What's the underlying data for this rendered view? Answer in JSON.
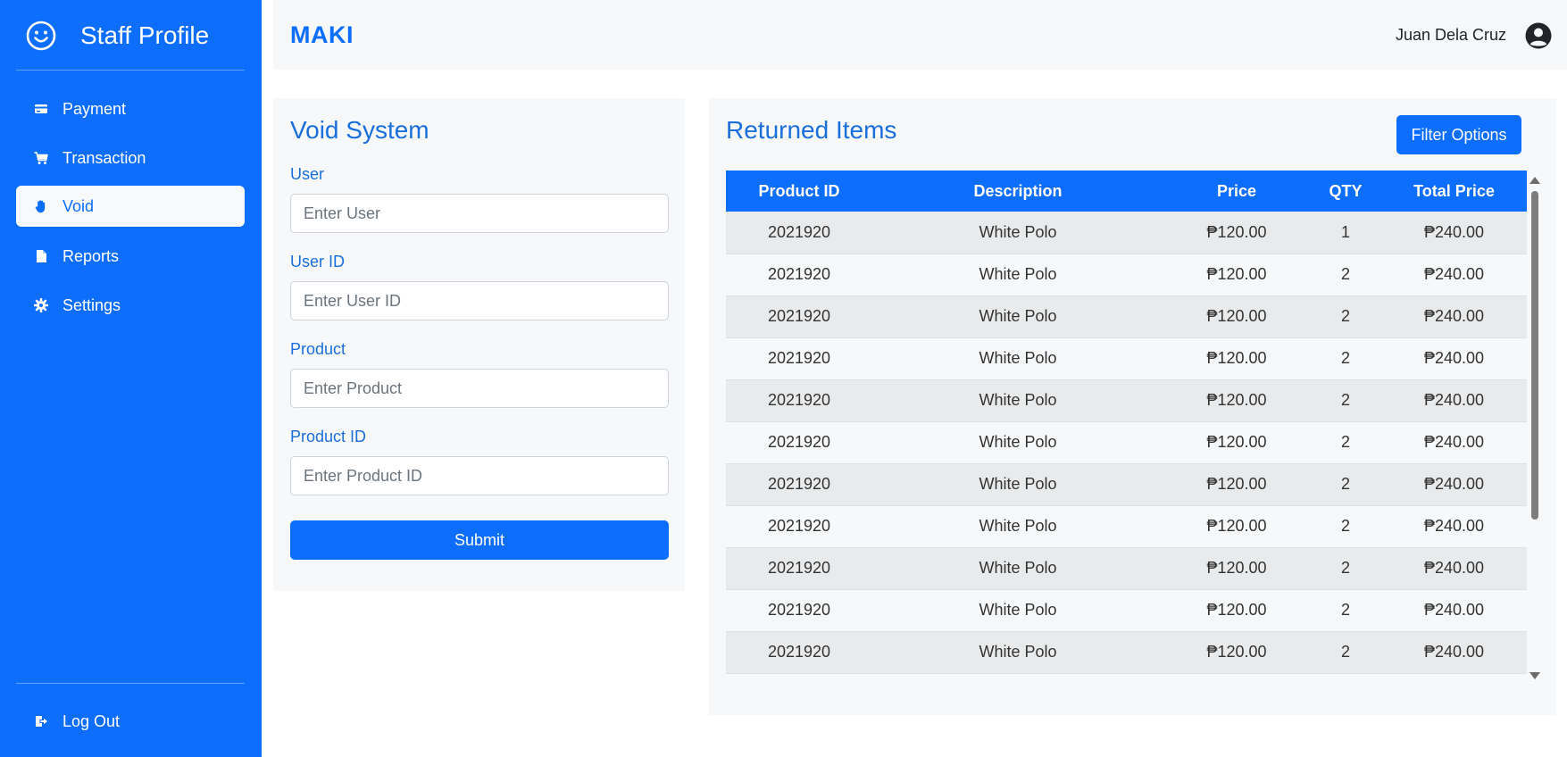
{
  "sidebar": {
    "title": "Staff Profile",
    "items": [
      {
        "label": "Payment",
        "icon": "credit-card-icon"
      },
      {
        "label": "Transaction",
        "icon": "cart-icon"
      },
      {
        "label": "Void",
        "icon": "hand-icon"
      },
      {
        "label": "Reports",
        "icon": "file-icon"
      },
      {
        "label": "Settings",
        "icon": "gear-icon"
      }
    ],
    "logout_label": "Log Out"
  },
  "header": {
    "logo": "MAKI",
    "user_name": "Juan Dela Cruz"
  },
  "void_form": {
    "title": "Void System",
    "fields": [
      {
        "label": "User",
        "placeholder": "Enter User",
        "value": ""
      },
      {
        "label": "User ID",
        "placeholder": "Enter User ID",
        "value": ""
      },
      {
        "label": "Product",
        "placeholder": "Enter Product",
        "value": ""
      },
      {
        "label": "Product ID",
        "placeholder": "Enter Product ID",
        "value": ""
      }
    ],
    "submit_label": "Submit"
  },
  "returned": {
    "title": "Returned Items",
    "filter_label": "Filter Options",
    "columns": [
      "Product ID",
      "Description",
      "Price",
      "QTY",
      "Total Price"
    ],
    "rows": [
      [
        "2021920",
        "White Polo",
        "₱120.00",
        "1",
        "₱240.00"
      ],
      [
        "2021920",
        "White Polo",
        "₱120.00",
        "2",
        "₱240.00"
      ],
      [
        "2021920",
        "White Polo",
        "₱120.00",
        "2",
        "₱240.00"
      ],
      [
        "2021920",
        "White Polo",
        "₱120.00",
        "2",
        "₱240.00"
      ],
      [
        "2021920",
        "White Polo",
        "₱120.00",
        "2",
        "₱240.00"
      ],
      [
        "2021920",
        "White Polo",
        "₱120.00",
        "2",
        "₱240.00"
      ],
      [
        "2021920",
        "White Polo",
        "₱120.00",
        "2",
        "₱240.00"
      ],
      [
        "2021920",
        "White Polo",
        "₱120.00",
        "2",
        "₱240.00"
      ],
      [
        "2021920",
        "White Polo",
        "₱120.00",
        "2",
        "₱240.00"
      ],
      [
        "2021920",
        "White Polo",
        "₱120.00",
        "2",
        "₱240.00"
      ],
      [
        "2021920",
        "White Polo",
        "₱120.00",
        "2",
        "₱240.00"
      ]
    ]
  },
  "colors": {
    "primary": "#0d6efd",
    "panel_bg": "#f7f8f9",
    "row_alt": "#e9eaeb"
  }
}
